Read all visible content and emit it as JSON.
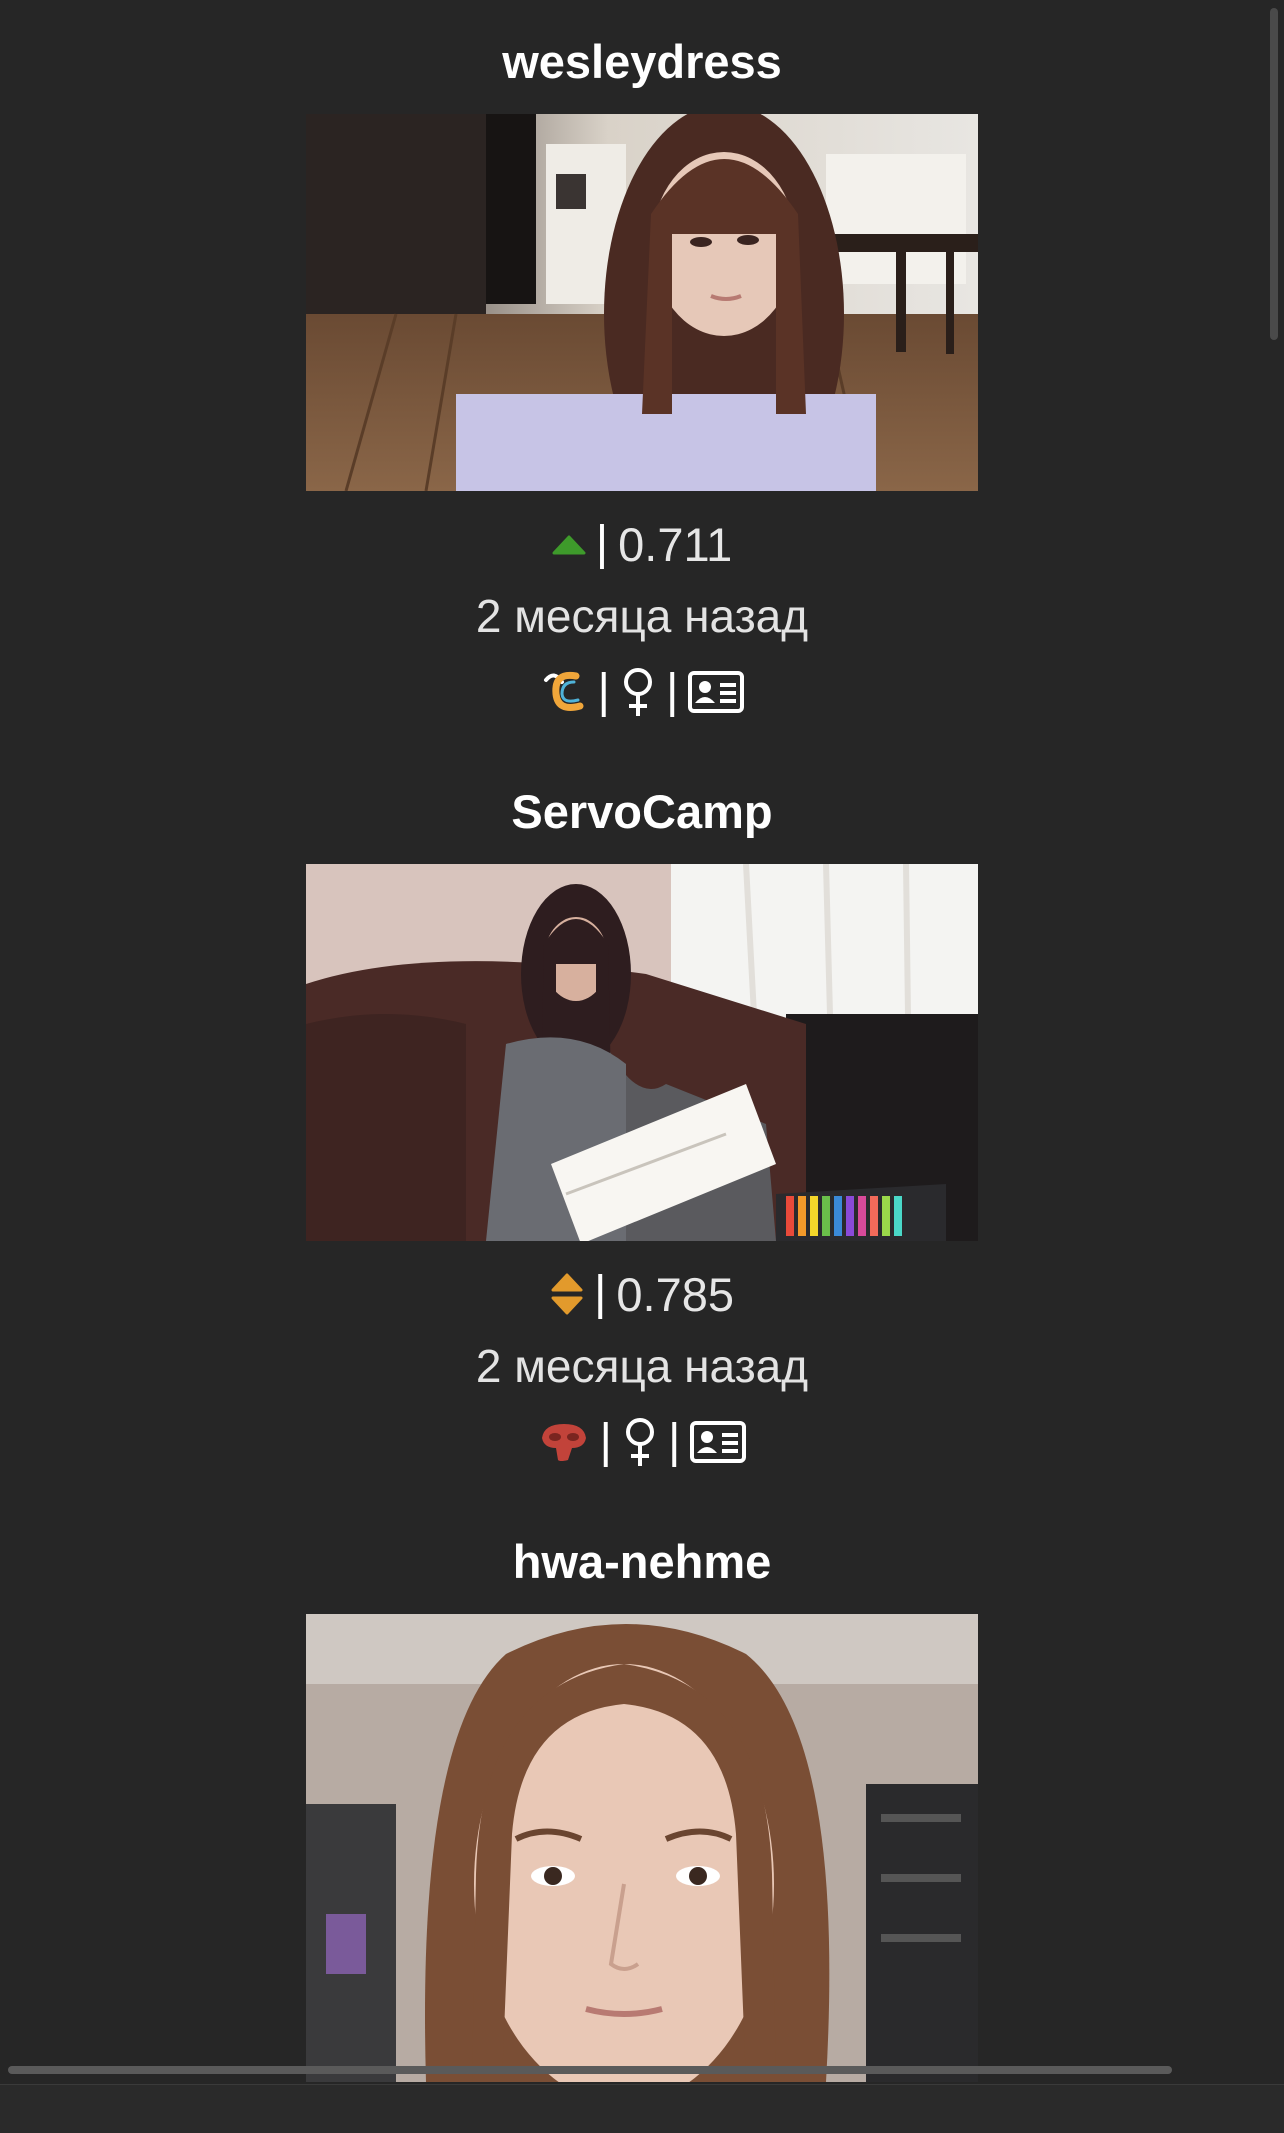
{
  "feed": {
    "items": [
      {
        "username": "wesleydress",
        "score": "0.711",
        "trend": "up",
        "trend_color": "#3e9a2b",
        "time_ago": "2 месяца назад",
        "platform_icon": "chaturbate-c-icon",
        "gender_icon": "female-icon",
        "profile_icon": "id-card-icon"
      },
      {
        "username": "ServoCamp",
        "score": "0.785",
        "trend": "neutral",
        "trend_color": "#e29a2c",
        "time_ago": "2 месяца назад",
        "platform_icon": "stripchat-mask-icon",
        "gender_icon": "female-icon",
        "profile_icon": "id-card-icon"
      },
      {
        "username": "hwa-nehme"
      }
    ],
    "separator": "|"
  },
  "colors": {
    "background": "#262626",
    "text": "#ffffff",
    "secondary_text": "#e3e3e3"
  }
}
